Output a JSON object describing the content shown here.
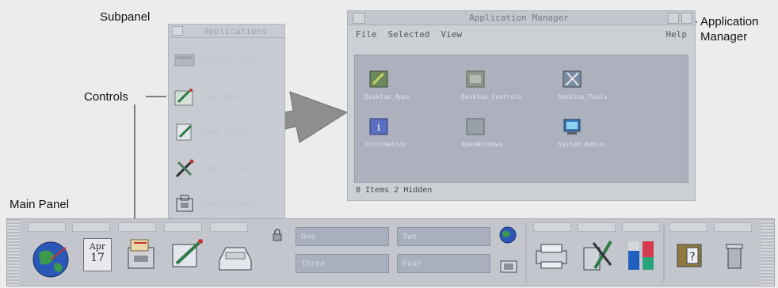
{
  "callouts": {
    "subpanel": "Subpanel",
    "controls": "Controls",
    "main_panel": "Main Panel",
    "app_manager_line1": "Application",
    "app_manager_line2": "Manager"
  },
  "subpanel": {
    "title": "Applications",
    "items": [
      {
        "label": "Install Icon",
        "icon": "install-icon"
      },
      {
        "label": "Text Note",
        "icon": "text-note-icon"
      },
      {
        "label": "Text Editor",
        "icon": "text-editor-icon"
      },
      {
        "label": "Applications",
        "icon": "app-tools-icon"
      },
      {
        "label": "Applications",
        "icon": "applications-icon"
      }
    ]
  },
  "app_manager": {
    "title": "Application Manager",
    "menus": [
      "File",
      "Selected",
      "View"
    ],
    "help": "Help",
    "items": [
      {
        "label": "Desktop_Apps",
        "icon": "desktop-apps-icon"
      },
      {
        "label": "Desktop_Controls",
        "icon": "desktop-controls-icon"
      },
      {
        "label": "Desktop_Tools",
        "icon": "desktop-tools-icon"
      },
      {
        "label": "Information",
        "icon": "information-icon"
      },
      {
        "label": "OpenWindows",
        "icon": "openwindows-icon"
      },
      {
        "label": "System_Admin",
        "icon": "system-admin-icon"
      }
    ],
    "status": "8 Items 2 Hidden"
  },
  "front_panel": {
    "calendar": {
      "month": "Apr",
      "day": "17"
    },
    "workspaces": [
      "One",
      "Two",
      "Three",
      "Four"
    ]
  }
}
